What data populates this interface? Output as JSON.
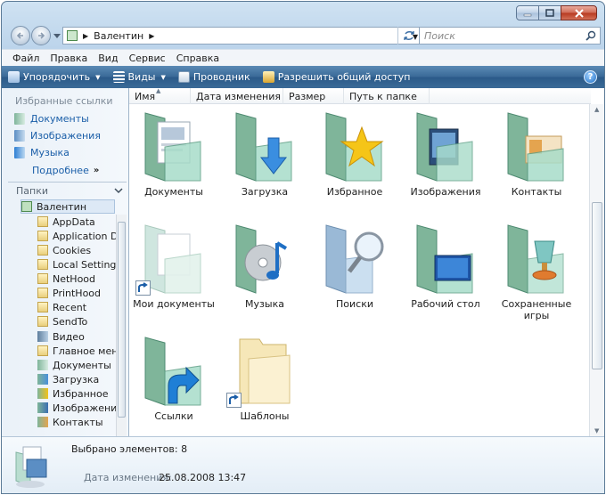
{
  "address": {
    "path": "Валентин"
  },
  "search": {
    "placeholder": "Поиск"
  },
  "menu": [
    "Файл",
    "Правка",
    "Вид",
    "Сервис",
    "Справка"
  ],
  "commands": {
    "organize": "Упорядочить",
    "views": "Виды",
    "explorer": "Проводник",
    "share": "Разрешить общий доступ"
  },
  "favorites": {
    "header": "Избранные ссылки",
    "items": [
      "Документы",
      "Изображения",
      "Музыка"
    ],
    "more": "Подробнее"
  },
  "folders": {
    "header": "Папки",
    "tree": [
      "Валентин",
      "AppData",
      "Application Da",
      "Cookies",
      "Local Settings",
      "NetHood",
      "PrintHood",
      "Recent",
      "SendTo",
      "Видео",
      "Главное меню",
      "Документы",
      "Загрузка",
      "Избранное",
      "Изображения",
      "Контакты"
    ]
  },
  "columns": [
    "Имя",
    "Дата изменения",
    "Размер",
    "Путь к папке"
  ],
  "items": [
    {
      "label": "Документы",
      "icon": "documents-folder-icon",
      "color": "#9fd6c6"
    },
    {
      "label": "Загрузка",
      "icon": "downloads-folder-icon",
      "color": "#4a90d9"
    },
    {
      "label": "Избранное",
      "icon": "favorites-folder-icon",
      "color": "#f2c21a"
    },
    {
      "label": "Изображения",
      "icon": "pictures-folder-icon",
      "color": "#3b6fb0"
    },
    {
      "label": "Контакты",
      "icon": "contacts-folder-icon",
      "color": "#e4a44f"
    },
    {
      "label": "Мои документы",
      "icon": "my-documents-shortcut-icon",
      "color": "#cfe6df"
    },
    {
      "label": "Музыка",
      "icon": "music-folder-icon",
      "color": "#2d7fd3"
    },
    {
      "label": "Поиски",
      "icon": "searches-folder-icon",
      "color": "#9ab9d6"
    },
    {
      "label": "Рабочий стол",
      "icon": "desktop-folder-icon",
      "color": "#2563b8"
    },
    {
      "label": "Сохраненные игры",
      "icon": "saved-games-folder-icon",
      "color": "#d9773b"
    },
    {
      "label": "Ссылки",
      "icon": "links-folder-icon",
      "color": "#1f7fd6"
    },
    {
      "label": "Шаблоны",
      "icon": "templates-shortcut-icon",
      "color": "#f6e7b8"
    }
  ],
  "details": {
    "count": "Выбрано элементов: 8",
    "date_label": "Дата изменения:",
    "date_value": "25.08.2008 13:47"
  }
}
